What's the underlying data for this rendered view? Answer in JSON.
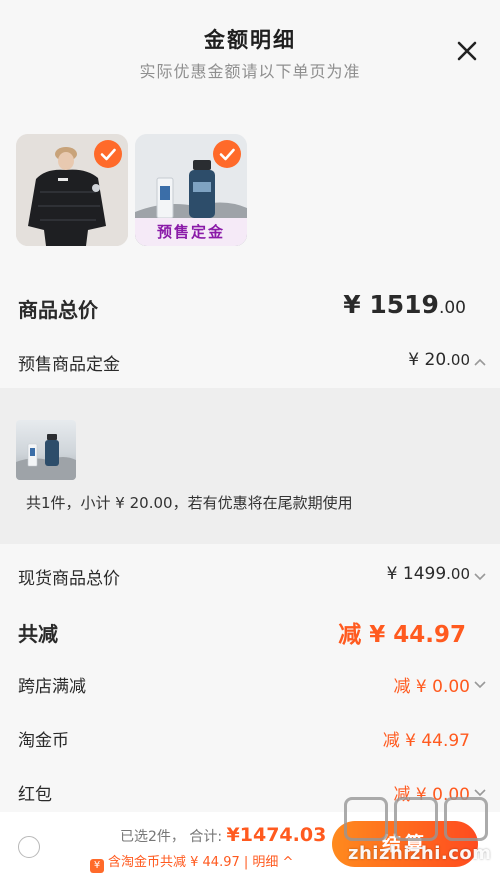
{
  "header": {
    "title": "金额明细",
    "subtitle": "实际优惠金额请以下单页为准"
  },
  "products": {
    "items": [
      {
        "image": "black-puffer-jacket-model",
        "checked": true
      },
      {
        "image": "skincare-products",
        "checked": true,
        "badge": "预售定金"
      }
    ]
  },
  "summary": {
    "total": {
      "label": "商品总价",
      "int": "¥ 1519",
      "dec": ".00"
    },
    "deposit": {
      "label": "预售商品定金",
      "int": "¥ 20",
      "dec": ".00"
    },
    "deposit_panel": {
      "note": "共1件，小计 ¥ 20.00，若有优惠将在尾款期使用"
    },
    "spot": {
      "label": "现货商品总价",
      "int": "¥ 1499",
      "dec": ".00"
    },
    "reduce": {
      "label": "共减",
      "value": "减 ¥ 44.97"
    },
    "cross_store": {
      "label": "跨店满减",
      "value": "减 ¥ 0.00"
    },
    "coin": {
      "label": "淘金币",
      "value": "减 ¥ 44.97"
    },
    "redpacket": {
      "label": "红包",
      "value": "减 ¥ 0.00"
    }
  },
  "bottom": {
    "selected": "已选2件，",
    "total_label": "合计:",
    "total_amount": "¥1474.03",
    "coin_icon": "¥",
    "coin_line": "含淘金币共减 ¥ 44.97 | 明细 ^",
    "checkout_label": "结算"
  },
  "watermark": {
    "text": "zhizhizhi.com"
  },
  "colors": {
    "accent": "#ff5a1f",
    "badge_text": "#8a1aa8",
    "badge_bg": "#f5eaf7"
  }
}
